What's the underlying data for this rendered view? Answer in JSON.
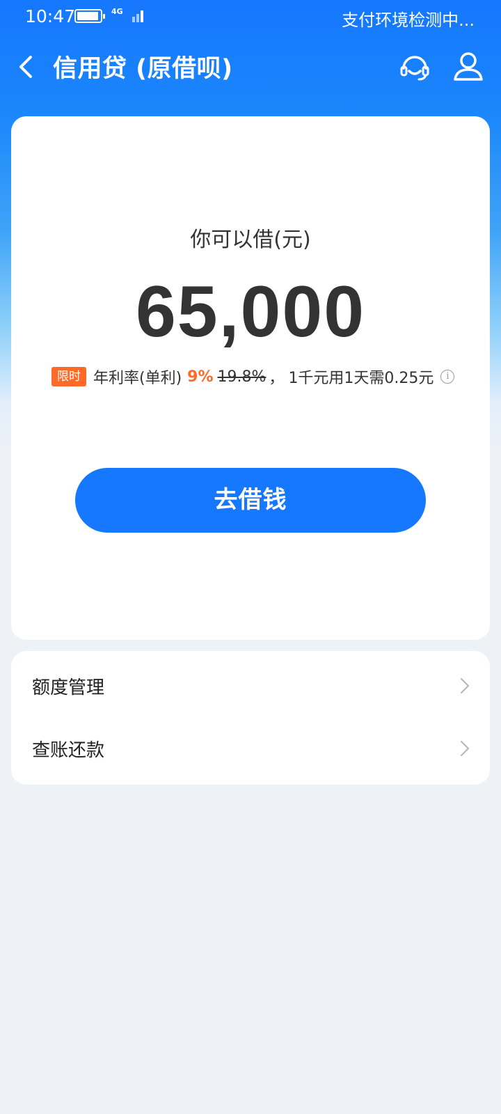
{
  "status_bar": {
    "time": "10:47",
    "network": "4G",
    "right_text": "支付环境检测中..."
  },
  "header": {
    "title": "信用贷 (原借呗)",
    "icons": [
      "back-arrow-icon",
      "customer-service-icon",
      "user-profile-icon"
    ]
  },
  "loan": {
    "label": "你可以借(元)",
    "amount": "65,000",
    "promo_tag": "限时",
    "rate_label": "年利率(单利)",
    "rate_current": "9%",
    "rate_original": "19.8%",
    "separator": "，",
    "daily_cost": "1千元用1天需0.25元",
    "info_icon_glyph": "i",
    "button_label": "去借钱"
  },
  "menu": {
    "items": [
      {
        "label": "额度管理"
      },
      {
        "label": "查账还款"
      }
    ]
  },
  "colors": {
    "primary": "#1677ff",
    "promo": "#ff6a2b",
    "background": "#eef1f6"
  }
}
